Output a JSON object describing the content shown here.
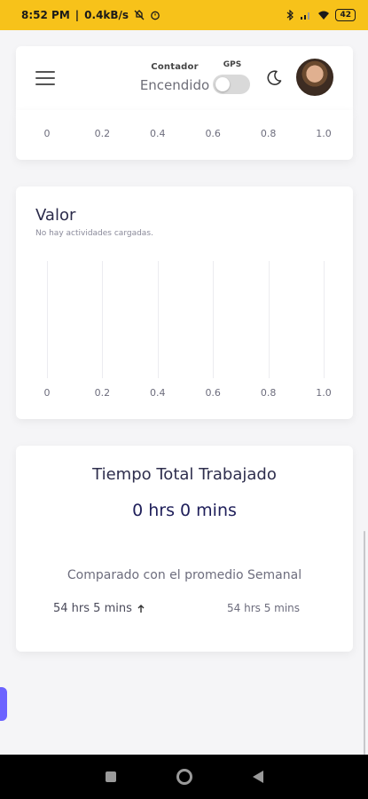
{
  "status_bar": {
    "time": "8:52 PM",
    "network_speed": "0.4kB/s",
    "battery": "42"
  },
  "header": {
    "counter_label": "Contador",
    "counter_value": "Encendido",
    "gps_label": "GPS",
    "gps_enabled": false
  },
  "chart_top": {
    "ticks": [
      "0",
      "0.2",
      "0.4",
      "0.6",
      "0.8",
      "1.0"
    ]
  },
  "chart_data": {
    "type": "bar",
    "title": "Valor",
    "subtitle": "No hay actividades cargadas.",
    "categories": [],
    "values": [],
    "xlim": [
      0,
      1.0
    ],
    "x_ticks": [
      "0",
      "0.2",
      "0.4",
      "0.6",
      "0.8",
      "1.0"
    ],
    "grid": true
  },
  "total": {
    "title": "Tiempo Total Trabajado",
    "value": "0 hrs 0 mins",
    "compare_label": "Comparado con el promedio Semanal",
    "compare_left": "54 hrs 5 mins",
    "compare_right": "54 hrs 5 mins"
  },
  "icons": {
    "menu": "hamburger-menu-icon",
    "theme": "moon-icon",
    "trend": "arrow-up-icon"
  }
}
